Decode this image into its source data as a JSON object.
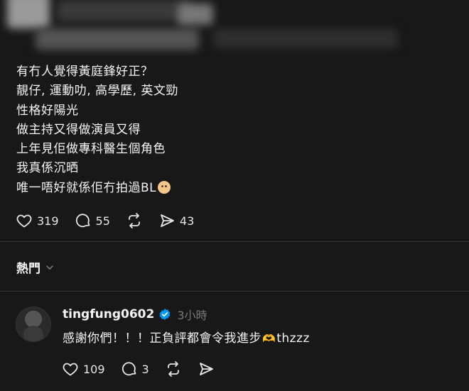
{
  "post": {
    "lines": [
      "有冇人覺得黃庭鋒好正？",
      "靚仔, 運動叻, 高學歷, 英文勁",
      "性格好陽光",
      "做主持又得做演員又得",
      "上年見佢做專科醫生個角色",
      "我真係沉晒",
      "唯一唔好就係佢冇拍過BL"
    ],
    "trailing_emoji": "flushed-face",
    "likes": "319",
    "comments": "55",
    "shares": "43"
  },
  "sort": {
    "label": "熱門"
  },
  "reply": {
    "username": "tingfung0602",
    "verified": true,
    "timestamp": "3小時",
    "text_before": "感謝你們！！！正負評都會令我進步",
    "heart_hands": "🫶",
    "text_after": "thzzz",
    "likes": "109",
    "comments": "3"
  },
  "colors": {
    "background": "#181818",
    "text": "#f3f5f7",
    "muted": "#777777",
    "verified_blue": "#0095f6"
  }
}
